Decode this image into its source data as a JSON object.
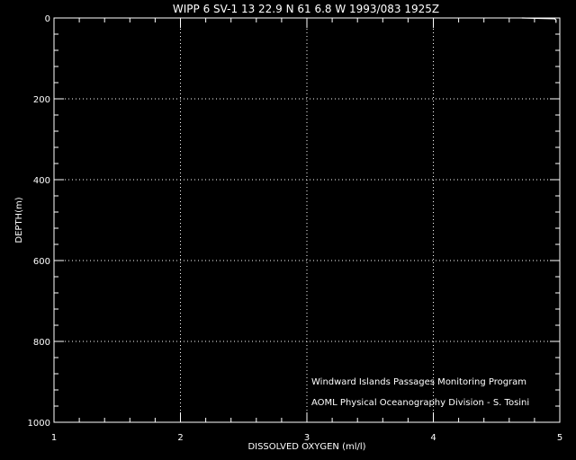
{
  "title": "WIPP 6 SV-1  13 22.9 N  61  6.8 W  1993/083 1925Z",
  "chart_data": {
    "type": "line",
    "xlabel": "DISSOLVED OXYGEN (ml/l)",
    "ylabel": "DEPTH(m)",
    "xlim": [
      1,
      5
    ],
    "ylim": [
      1000,
      0
    ],
    "y_inverted": true,
    "x_ticks": [
      "1",
      "2",
      "3",
      "4",
      "5"
    ],
    "y_ticks": [
      "0",
      "200",
      "400",
      "600",
      "800",
      "1000"
    ],
    "grid": true,
    "grid_style": "dotted",
    "series": [
      {
        "points": [
          [
            4.7,
            0
          ],
          [
            4.96,
            2
          ],
          [
            4.97,
            5
          ],
          [
            4.97,
            12
          ]
        ]
      }
    ],
    "annotations": [
      "Windward Islands Passages Monitoring Program",
      "AOML Physical Oceanography Division - S. Tosini"
    ]
  },
  "colors": {
    "background": "#000000",
    "foreground": "#ffffff"
  }
}
